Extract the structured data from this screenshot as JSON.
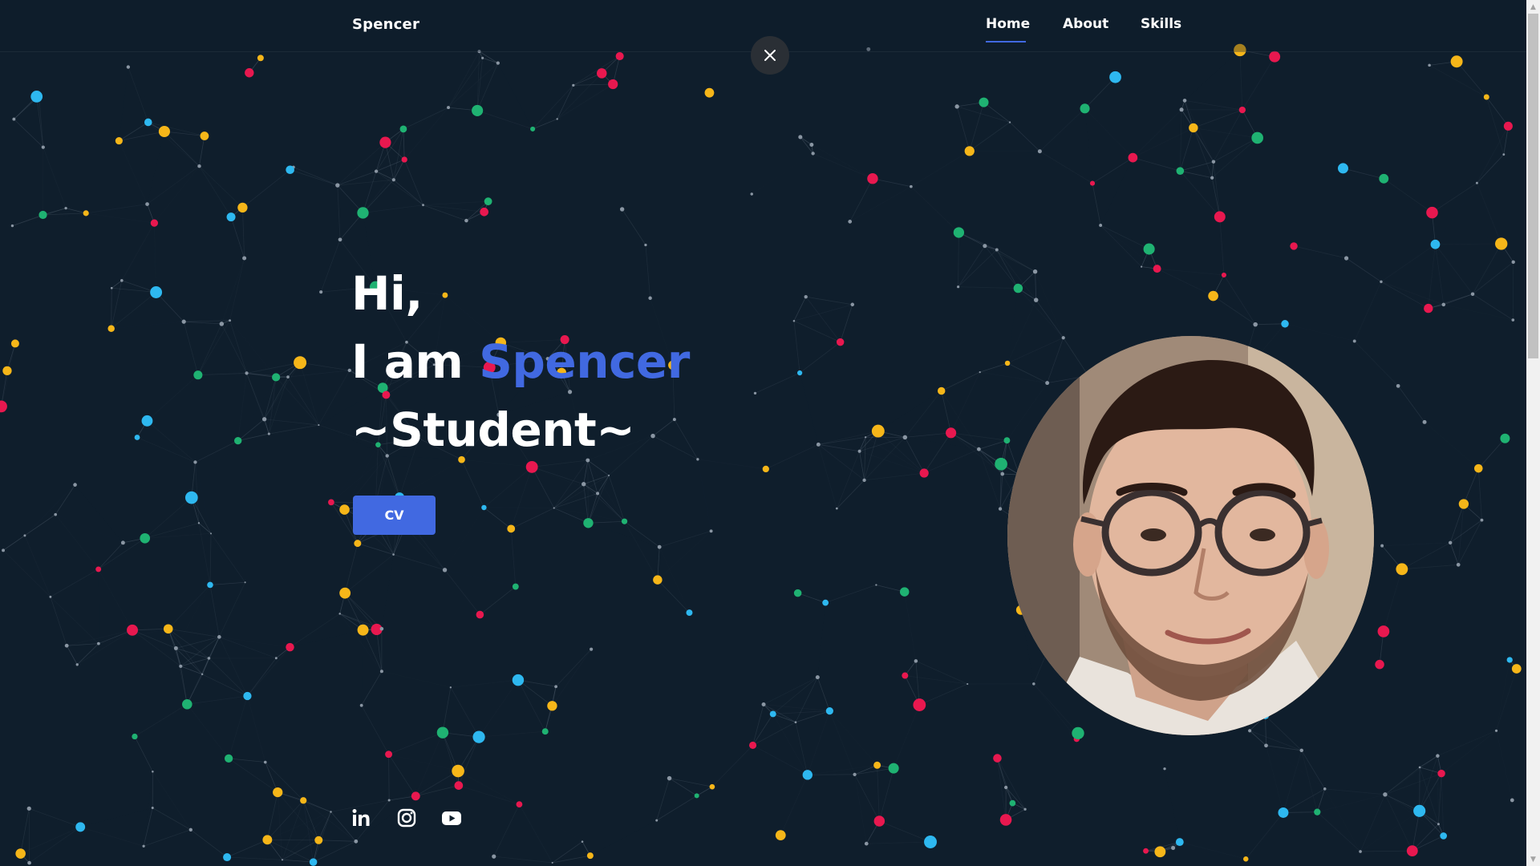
{
  "header": {
    "brand": "Spencer",
    "nav": [
      {
        "label": "Home",
        "active": true
      },
      {
        "label": "About",
        "active": false
      },
      {
        "label": "Skills",
        "active": false
      }
    ],
    "close_icon": "close-icon"
  },
  "hero": {
    "greeting": "Hi,",
    "intro_prefix": "I am",
    "name": "Spencer",
    "role": "~Student~",
    "cv_label": "CV"
  },
  "profile": {
    "photo": "profile-photo"
  },
  "social": [
    {
      "icon": "linkedin-icon"
    },
    {
      "icon": "instagram-icon"
    },
    {
      "icon": "youtube-icon"
    }
  ],
  "colors": {
    "background": "#0f1e2c",
    "accent": "#4169e1",
    "particle_pink": "#e8184f",
    "particle_yellow": "#f6b619",
    "particle_green": "#1fb272",
    "particle_blue": "#2eb8f0"
  }
}
